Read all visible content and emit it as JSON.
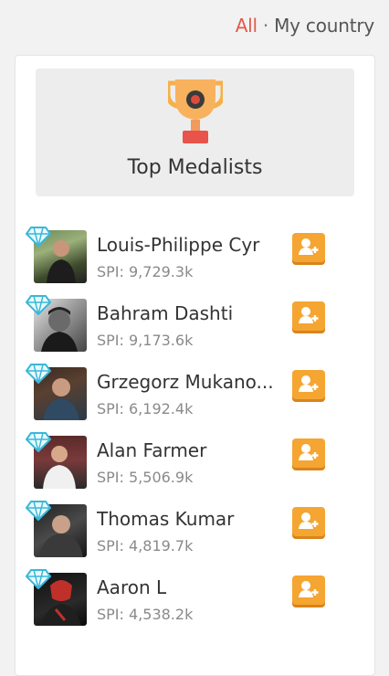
{
  "filter": {
    "all_label": "All",
    "separator": "·",
    "country_label": "My country"
  },
  "widget": {
    "title": "Top Medalists"
  },
  "medalists": [
    {
      "name": "Louis-Philippe Cyr",
      "spi": "SPI: 9,729.3k"
    },
    {
      "name": "Bahram Dashti",
      "spi": "SPI: 9,173.6k"
    },
    {
      "name": "Grzegorz Mukano...",
      "spi": "SPI: 6,192.4k"
    },
    {
      "name": "Alan Farmer",
      "spi": "SPI: 5,506.9k"
    },
    {
      "name": "Thomas Kumar",
      "spi": "SPI: 4,819.7k"
    },
    {
      "name": "Aaron L",
      "spi": "SPI: 4,538.2k"
    }
  ],
  "icons": {
    "badge": "diamond-icon",
    "follow": "add-friend-icon",
    "banner": "trophy-icon"
  },
  "colors": {
    "active_filter": "#e05a4a",
    "follow_button": "#f5a531",
    "diamond": "#5fd0e8"
  }
}
